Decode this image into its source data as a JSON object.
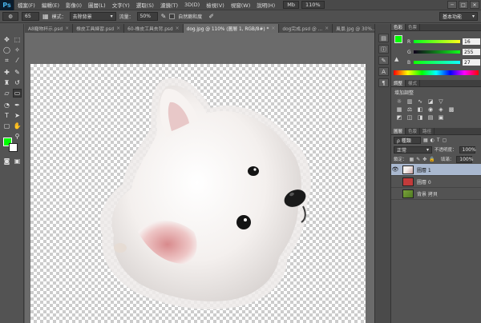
{
  "menubar": {
    "logo": "Ps",
    "items": [
      "檔案(F)",
      "編輯(E)",
      "影像(I)",
      "圖層(L)",
      "文字(Y)",
      "選取(S)",
      "濾鏡(T)",
      "3D(D)",
      "檢視(V)",
      "視窗(W)",
      "說明(H)"
    ],
    "mb": "Mb",
    "zoom": "110%",
    "window_controls": [
      "─",
      "□",
      "✕"
    ]
  },
  "options": {
    "brush_size": "65",
    "mode_label": "模式：",
    "mode_value": "去除背景",
    "flow_label": "流量：",
    "flow_value": "50%",
    "checkbox_label": "自然飽和度",
    "workspace": "基本功能"
  },
  "tabs": [
    {
      "label": "A8寵物杯示.psd",
      "active": false
    },
    {
      "label": "橡皮工具練習.psd",
      "active": false
    },
    {
      "label": "60-橡皮工具去背.psd",
      "active": false
    },
    {
      "label": "dog.jpg @ 110% (圖層 1, RGB/8#) *",
      "active": true
    },
    {
      "label": "dog完成.psd @ ...",
      "active": false
    },
    {
      "label": "風景.jpg @ 30%...",
      "active": false
    }
  ],
  "color_panel": {
    "tabs": [
      "色彩",
      "色票"
    ],
    "r_label": "R",
    "r_value": "16",
    "g_label": "G",
    "g_value": "255",
    "b_label": "B",
    "b_value": "27",
    "foreground": "#00ff00",
    "background": "#ffffff"
  },
  "adjust_panel": {
    "tabs": [
      "調整",
      "樣式"
    ],
    "title": "增加調整"
  },
  "layers_panel": {
    "tabs": [
      "圖層",
      "色版",
      "路徑"
    ],
    "kind": "ρ 種類",
    "blend_mode": "正常",
    "opacity_label": "不透明度：",
    "opacity_value": "100%",
    "lock_label": "鎖定：",
    "fill_label": "填滿：",
    "fill_value": "100%",
    "layers": [
      {
        "name": "圖層 1",
        "selected": true,
        "visible": true
      },
      {
        "name": "圖層 0",
        "selected": false,
        "visible": false
      },
      {
        "name": "背景 拷貝",
        "selected": false,
        "visible": false
      }
    ]
  }
}
